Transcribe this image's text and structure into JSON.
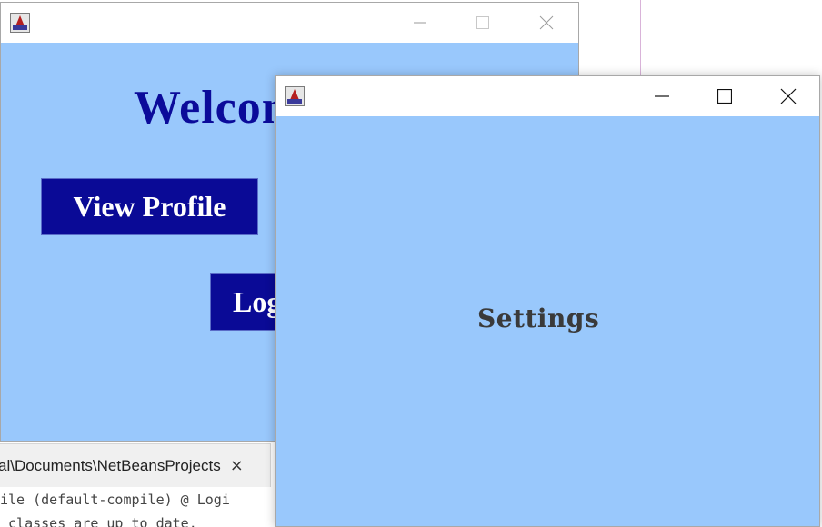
{
  "background_ide": {
    "tab_label": "al\\Documents\\NetBeansProjects",
    "tab_close": "×",
    "console_lines": [
      "ile (default-compile) @ Logi",
      " classes are up to date."
    ]
  },
  "main_window": {
    "welcome_text": "Welcome",
    "view_profile_label": "View Profile",
    "logout_label": "Logout"
  },
  "settings_window": {
    "label": "Settings"
  },
  "colors": {
    "window_bg": "#99c8fc",
    "button_bg": "#0a0a96",
    "welcome_text": "#0b0b9a"
  }
}
